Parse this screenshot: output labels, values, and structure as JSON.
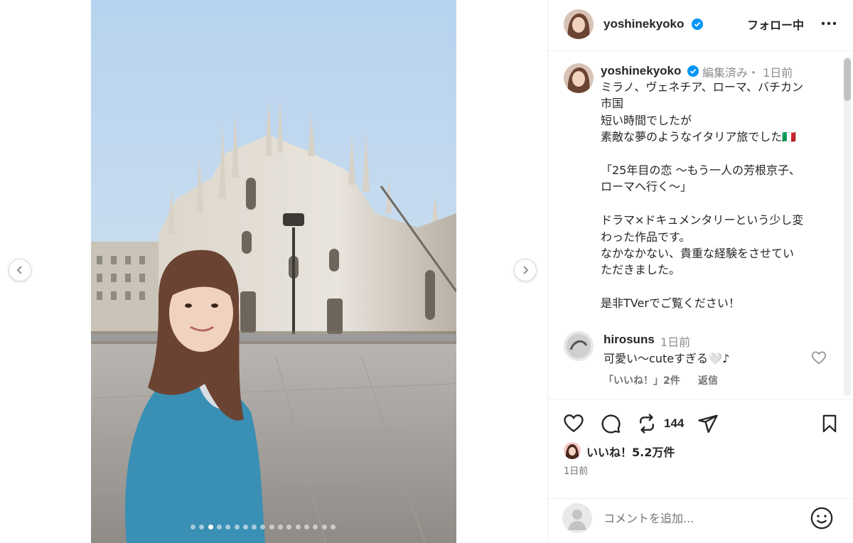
{
  "post": {
    "username": "yoshinekyoko",
    "follow_label": "フォロー中",
    "more_icon": "more-horizontal-icon",
    "media": {
      "slide_count": 17,
      "active_slide": 3
    }
  },
  "caption": {
    "username": "yoshinekyoko",
    "meta": "編集済み・ 1日前",
    "lines": [
      "ミラノ、ヴェネチア、ローマ、バチカン",
      "市国",
      "短い時間でしたが",
      "素敵な夢のようなイタリア旅でした🇮🇹",
      "",
      "「25年目の恋 〜もう一人の芳根京子、",
      "ローマへ行く〜」",
      "",
      "ドラマ×ドキュメンタリーという少し変",
      "わった作品です。",
      "なかなかない、貴重な経験をさせてい",
      "ただきました。",
      "",
      "是非TVerでご覧ください！"
    ]
  },
  "comment": {
    "username": "hirosuns",
    "time": "1日前",
    "text": "可愛い〜cuteすぎる🤍♪",
    "likes": "「いいね！」2件",
    "reply_label": "返信"
  },
  "actions": {
    "repost_count": "144",
    "likes_text": "いいね！5.2万件",
    "time": "1日前"
  },
  "add_comment": {
    "placeholder": "コメントを追加..."
  },
  "colors": {
    "verified": "#0095f6",
    "text": "#262626",
    "muted": "#8e8e8e"
  }
}
